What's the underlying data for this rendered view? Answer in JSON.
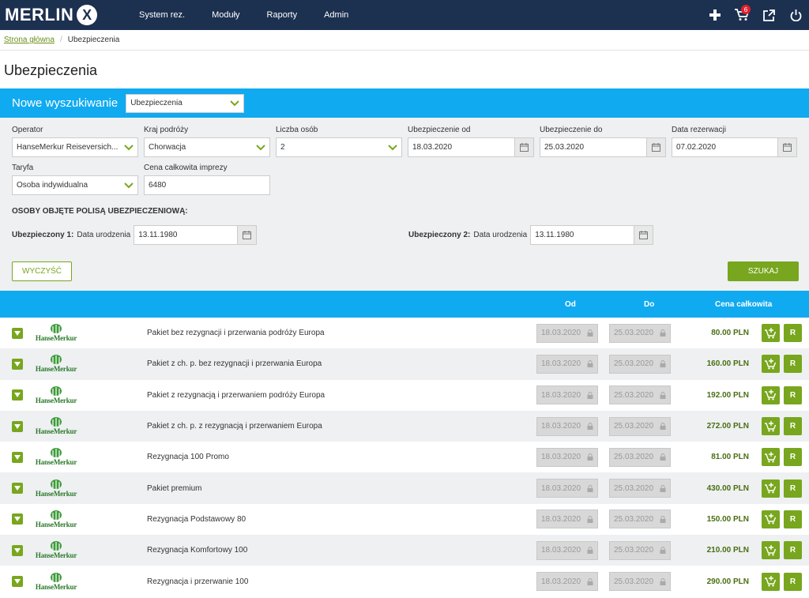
{
  "app": {
    "logo_text": "MERLIN",
    "logo_mark": "X"
  },
  "nav": {
    "items": [
      "System rez.",
      "Moduły",
      "Raporty",
      "Admin"
    ],
    "cart_count": "6"
  },
  "breadcrumb": {
    "home": "Strona główna",
    "current": "Ubezpieczenia"
  },
  "page_title": "Ubezpieczenia",
  "search": {
    "title": "Nowe wyszukiwanie",
    "type_value": "Ubezpieczenia",
    "operator_label": "Operator",
    "operator_value": "HanseMerkur Reiseversich...",
    "country_label": "Kraj podróży",
    "country_value": "Chorwacja",
    "persons_label": "Liczba osób",
    "persons_value": "2",
    "from_label": "Ubezpieczenie od",
    "from_value": "18.03.2020",
    "to_label": "Ubezpieczenie do",
    "to_value": "25.03.2020",
    "booking_label": "Data rezerwacji",
    "booking_value": "07.02.2020",
    "tariff_label": "Taryfa",
    "tariff_value": "Osoba indywidualna",
    "price_label": "Cena całkowita imprezy",
    "price_value": "6480",
    "persons_section": "OSOBY OBJĘTE POLISĄ UBEZPIECZENIOWĄ:",
    "insured1_label": "Ubezpieczony 1:",
    "insured2_label": "Ubezpieczony 2:",
    "birth_label": "Data urodzenia",
    "insured1_birth": "13.11.1980",
    "insured2_birth": "13.11.1980",
    "clear_label": "WYCZYŚĆ",
    "search_label": "SZUKAJ"
  },
  "results": {
    "col_from": "Od",
    "col_to": "Do",
    "col_price": "Cena całkowita",
    "brand": "HanseMerkur",
    "reserve_label": "R",
    "rows": [
      {
        "name": "Pakiet bez rezygnacji i przerwania podróży Europa",
        "from": "18.03.2020",
        "to": "25.03.2020",
        "price": "80.00 PLN"
      },
      {
        "name": "Pakiet z ch. p. bez rezygnacji i przerwania Europa",
        "from": "18.03.2020",
        "to": "25.03.2020",
        "price": "160.00 PLN"
      },
      {
        "name": "Pakiet z rezygnacją i przerwaniem podróży Europa",
        "from": "18.03.2020",
        "to": "25.03.2020",
        "price": "192.00 PLN"
      },
      {
        "name": "Pakiet z ch. p. z rezygnacją i przerwaniem Europa",
        "from": "18.03.2020",
        "to": "25.03.2020",
        "price": "272.00 PLN"
      },
      {
        "name": "Rezygnacja 100 Promo",
        "from": "18.03.2020",
        "to": "25.03.2020",
        "price": "81.00 PLN"
      },
      {
        "name": "Pakiet premium",
        "from": "18.03.2020",
        "to": "25.03.2020",
        "price": "430.00 PLN"
      },
      {
        "name": "Rezygnacja Podstawowy 80",
        "from": "18.03.2020",
        "to": "25.03.2020",
        "price": "150.00 PLN"
      },
      {
        "name": "Rezygnacja Komfortowy 100",
        "from": "18.03.2020",
        "to": "25.03.2020",
        "price": "210.00 PLN"
      },
      {
        "name": "Rezygnacja i przerwanie 100",
        "from": "18.03.2020",
        "to": "25.03.2020",
        "price": "290.00 PLN"
      }
    ]
  },
  "colors": {
    "navy": "#1c3050",
    "blue": "#10aaf0",
    "green": "#78a61e"
  }
}
